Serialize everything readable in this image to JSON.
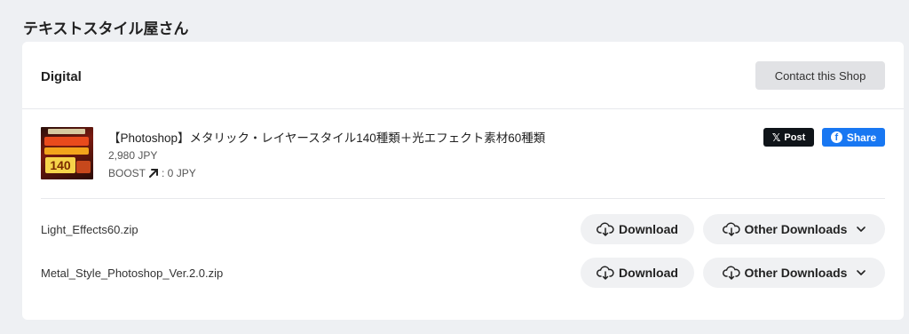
{
  "shop": {
    "name": "テキストスタイル屋さん"
  },
  "card": {
    "title": "Digital",
    "contact_label": "Contact this Shop"
  },
  "product": {
    "thumbnail_text": "140",
    "name": "【Photoshop】メタリック・レイヤースタイル140種類＋光エフェクト素材60種類",
    "price": "2,980 JPY",
    "boost_label": "BOOST",
    "boost_value": ": 0 JPY",
    "x_post_label": "Post",
    "fb_share_label": "Share",
    "x_icon": "𝕏",
    "fb_icon": "f"
  },
  "files": [
    {
      "name": "Light_Effects60.zip",
      "download_label": "Download",
      "other_label": "Other Downloads"
    },
    {
      "name": "Metal_Style_Photoshop_Ver.2.0.zip",
      "download_label": "Download",
      "other_label": "Other Downloads"
    }
  ],
  "colors": {
    "x_button": "#0f1419",
    "fb_button": "#1877f2",
    "page_bg": "#eef0f3"
  }
}
